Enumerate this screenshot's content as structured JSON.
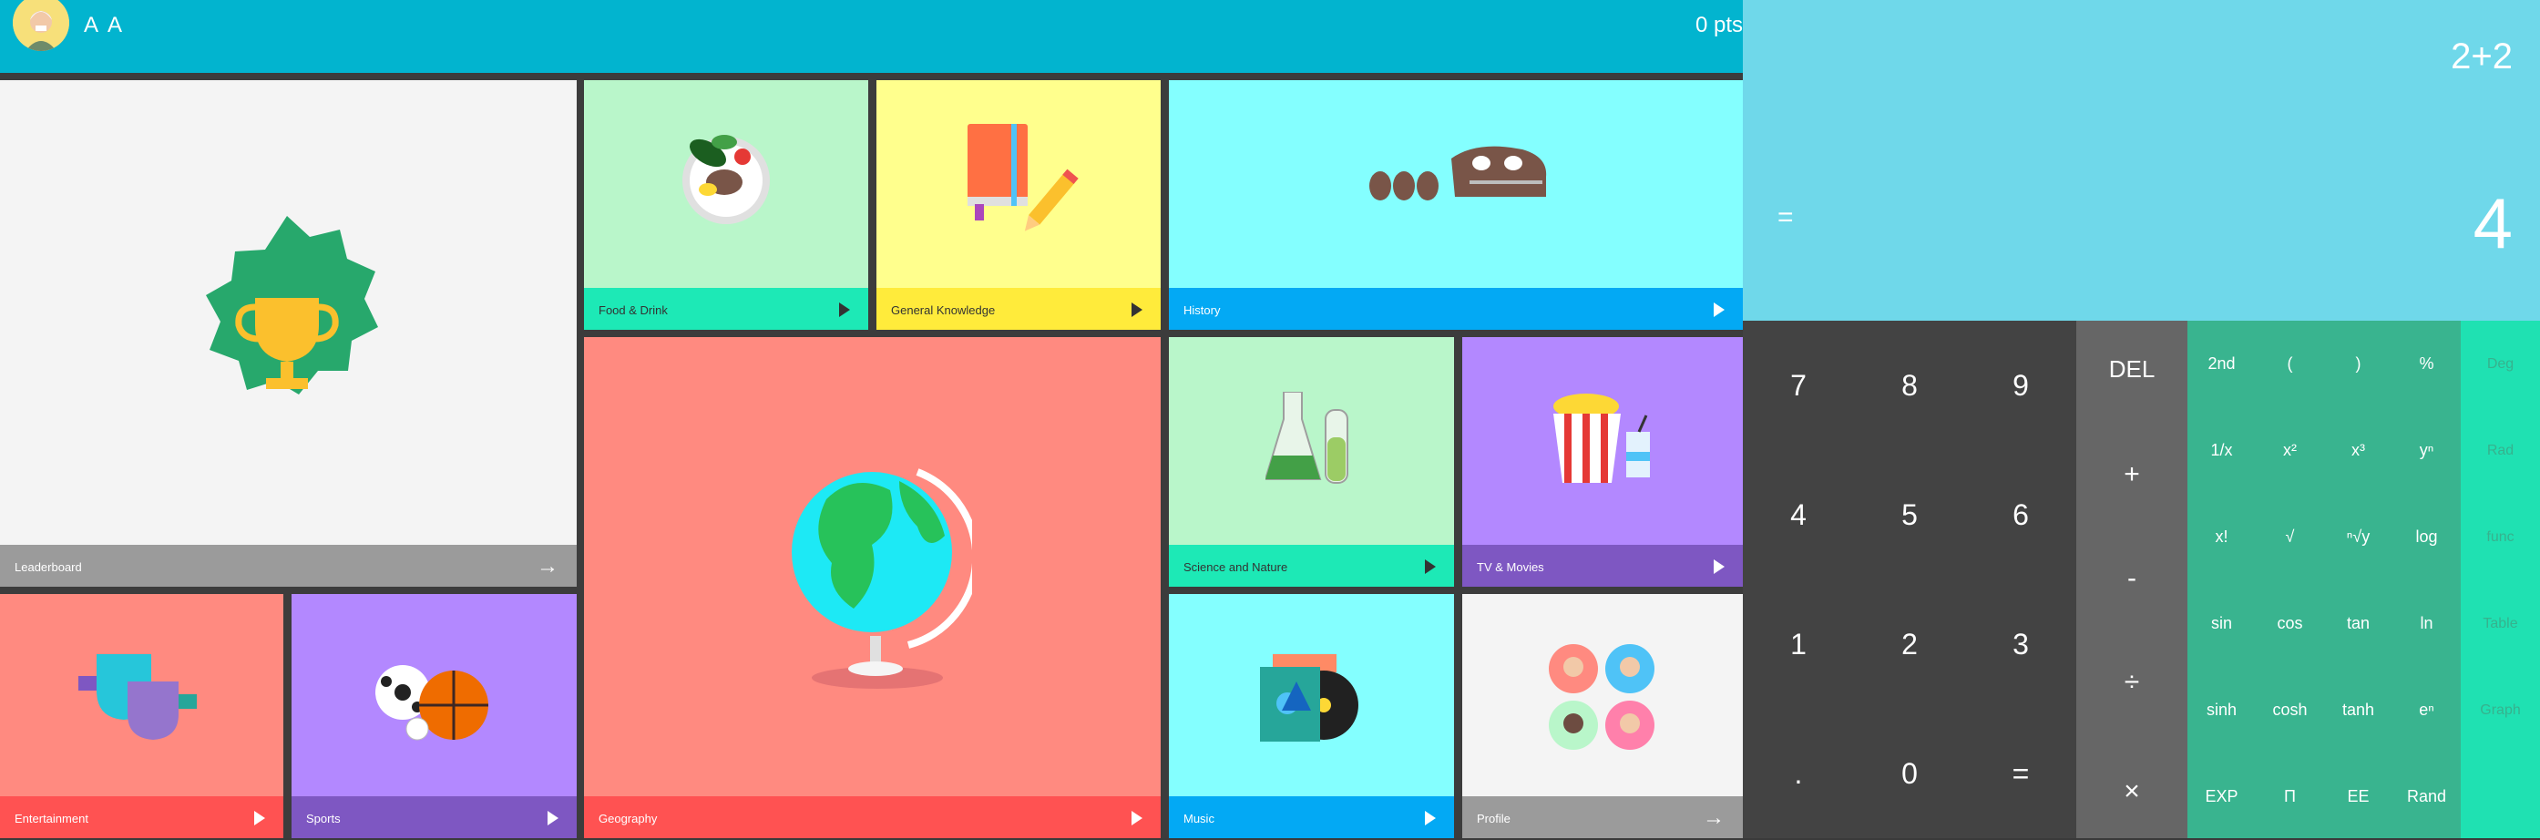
{
  "quiz": {
    "user_name": "A A",
    "points": "0 pts",
    "tiles": {
      "leaderboard": "Leaderboard",
      "food": "Food & Drink",
      "general": "General Knowledge",
      "history": "History",
      "geography": "Geography",
      "science": "Science and Nature",
      "tv": "TV & Movies",
      "entertainment": "Entertainment",
      "sports": "Sports",
      "music": "Music",
      "profile": "Profile"
    }
  },
  "calculator": {
    "expression": "2+2",
    "equals_sign": "=",
    "result": "4",
    "numpad": [
      "7",
      "8",
      "9",
      "4",
      "5",
      "6",
      "1",
      "2",
      "3",
      ".",
      "0",
      "="
    ],
    "ops": [
      "DEL",
      "+",
      "-",
      "÷",
      "×"
    ],
    "scientific": [
      "2nd",
      "(",
      ")",
      "%",
      "1/x",
      "x²",
      "x³",
      "yⁿ",
      "x!",
      "√",
      "ⁿ√y",
      "log",
      "sin",
      "cos",
      "tan",
      "ln",
      "sinh",
      "cosh",
      "tanh",
      "eⁿ",
      "EXP",
      "Π",
      "EE",
      "Rand"
    ],
    "side_panel": [
      "Deg",
      "Rad",
      "func",
      "Table",
      "Graph"
    ]
  },
  "colors": {
    "topbar": "#02b4cf",
    "calc_display": "#6fd8ea",
    "sci_pad": "#39b48f",
    "side_pad": "#1fe1b2"
  }
}
